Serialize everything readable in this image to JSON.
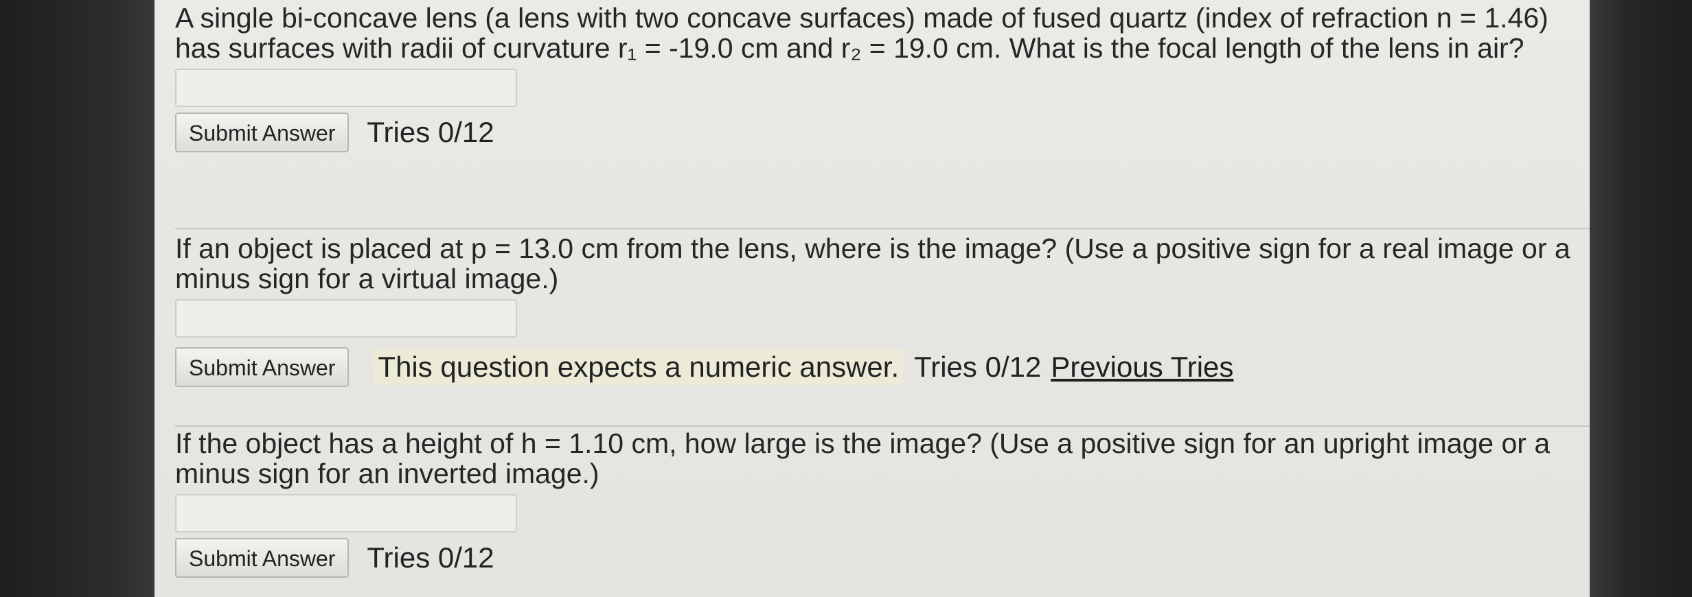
{
  "questions": [
    {
      "text": "A single bi-concave lens (a lens with two concave surfaces) made of fused quartz (index of refraction n = 1.46) has surfaces with radii of curvature r₁ = -19.0 cm and r₂ = 19.0 cm. What is the focal length of the lens in air?",
      "answer_value": "",
      "submit_label": "Submit Answer",
      "tries": "Tries 0/12"
    },
    {
      "text": "If an object is placed at p = 13.0 cm from the lens, where is the image? (Use a positive sign for a real image or a minus sign for a virtual image.)",
      "answer_value": "",
      "submit_label": "Submit Answer",
      "expects": "This question expects a numeric answer.",
      "tries": "Tries 0/12",
      "previous_tries": "Previous Tries"
    },
    {
      "text": "If the object has a height of h = 1.10 cm, how large is the image? (Use a positive sign for an upright image or a minus sign for an inverted image.)",
      "answer_value": "",
      "submit_label": "Submit Answer",
      "tries": "Tries 0/12"
    }
  ]
}
